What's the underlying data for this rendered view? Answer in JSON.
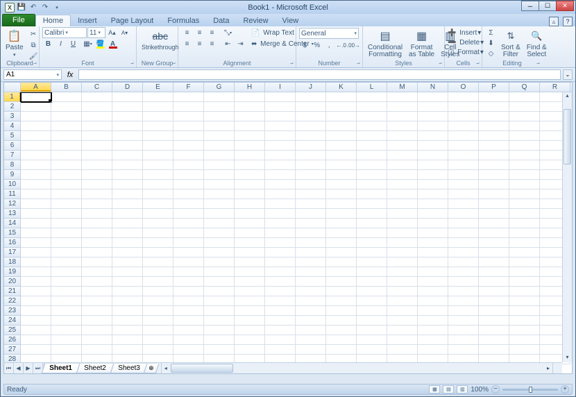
{
  "title": "Book1 - Microsoft Excel",
  "qat": {
    "save_tip": "💾",
    "undo_tip": "↶",
    "redo_tip": "↷"
  },
  "tabs": {
    "file": "File",
    "home": "Home",
    "insert": "Insert",
    "pagelayout": "Page Layout",
    "formulas": "Formulas",
    "data": "Data",
    "review": "Review",
    "view": "View"
  },
  "clipboard": {
    "label": "Clipboard",
    "paste": "Paste"
  },
  "font": {
    "label": "Font",
    "name": "Calibri",
    "size": "11",
    "grow": "A▴",
    "shrink": "A▾",
    "bold": "B",
    "italic": "I",
    "underline": "U"
  },
  "newgroup": {
    "label": "New Group",
    "strike": "Strikethrough",
    "strike_abc": "abc"
  },
  "alignment": {
    "label": "Alignment",
    "wrap": "Wrap Text",
    "merge": "Merge & Center"
  },
  "number": {
    "label": "Number",
    "format": "General",
    "currency": "$",
    "percent": "%",
    "comma": ",",
    "incdec": ".0",
    "decdec": ".00"
  },
  "styles": {
    "label": "Styles",
    "cond": "Conditional\nFormatting",
    "table": "Format\nas Table",
    "cell": "Cell\nStyles"
  },
  "cells": {
    "label": "Cells",
    "insert": "Insert",
    "delete": "Delete",
    "format": "Format"
  },
  "editing": {
    "label": "Editing",
    "sum": "Σ",
    "fill": "⬇",
    "clear": "◇",
    "sort": "Sort &\nFilter",
    "find": "Find &\nSelect"
  },
  "namebox": "A1",
  "columns": [
    "A",
    "B",
    "C",
    "D",
    "E",
    "F",
    "G",
    "H",
    "I",
    "J",
    "K",
    "L",
    "M",
    "N",
    "O",
    "P",
    "Q",
    "R"
  ],
  "rows": [
    1,
    2,
    3,
    4,
    5,
    6,
    7,
    8,
    9,
    10,
    11,
    12,
    13,
    14,
    15,
    16,
    17,
    18,
    19,
    20,
    21,
    22,
    23,
    24,
    25,
    26,
    27,
    28
  ],
  "selected": {
    "col": "A",
    "row": 1
  },
  "sheets": {
    "s1": "Sheet1",
    "s2": "Sheet2",
    "s3": "Sheet3"
  },
  "status": {
    "ready": "Ready",
    "zoom": "100%"
  }
}
